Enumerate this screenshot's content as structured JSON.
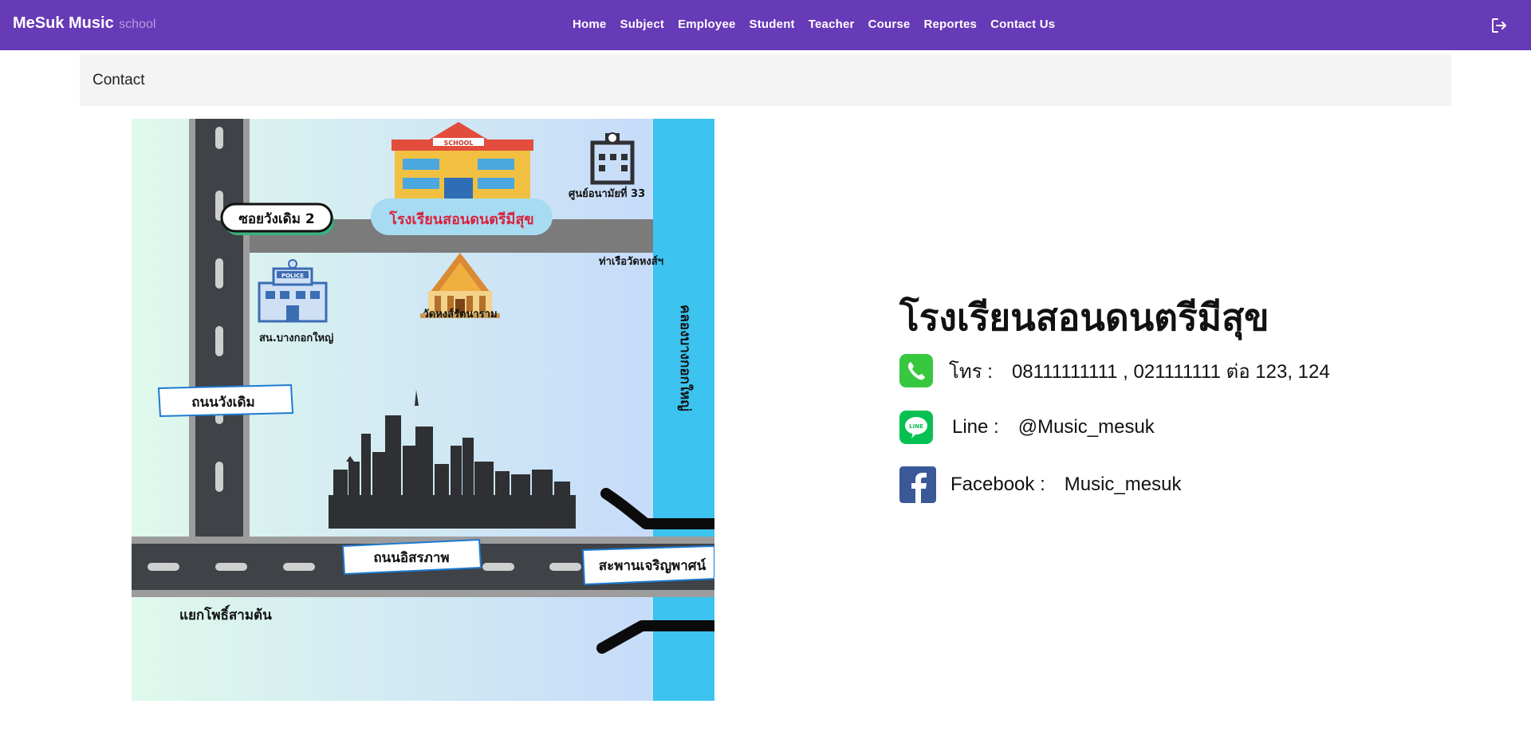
{
  "app": {
    "brand_main": "MeSuk Music",
    "brand_sub": "school"
  },
  "nav": {
    "items": [
      {
        "label": "Home"
      },
      {
        "label": "Subject"
      },
      {
        "label": "Employee"
      },
      {
        "label": "Student"
      },
      {
        "label": "Teacher"
      },
      {
        "label": "Course"
      },
      {
        "label": "Reportes"
      },
      {
        "label": "Contact Us"
      }
    ],
    "logout_icon": "logout-icon"
  },
  "page": {
    "breadcrumb_title": "Contact"
  },
  "map": {
    "labels": {
      "soi": "ซอยวังเดิม 2",
      "school": "โรงเรียนสอนดนตรีมีสุข",
      "health_center": "ศูนย์อนามัยที่ 33",
      "pier": "ท่าเรือวัดหงส์ฯ",
      "temple": "วัดหงส์รัตนาราม",
      "police": "สน.บางกอกใหญ่",
      "road_wongdoem": "ถนนวังเดิม",
      "canal": "คลองบางกอกใหญ่",
      "road_itsaraphap": "ถนนอิสรภาพ",
      "bridge": "สะพานเจริญพาศน์",
      "intersection": "แยกโพธิ์สามต้น",
      "school_sign": "SCHOOL",
      "police_sign": "POLICE"
    },
    "colors": {
      "canal": "#3cc3f0",
      "road": "#3f4247",
      "skyline": "#2e3033"
    }
  },
  "contact": {
    "school_name": "โรงเรียนสอนดนตรีมีสุข",
    "phone": {
      "icon": "phone-icon",
      "label": "โทร :",
      "value": "08111111111 , 021111111 ต่อ 123, 124"
    },
    "line": {
      "icon": "line-icon",
      "label": "Line :",
      "value": "@Music_mesuk"
    },
    "facebook": {
      "icon": "facebook-icon",
      "label": "Facebook :",
      "value": "Music_mesuk"
    }
  }
}
